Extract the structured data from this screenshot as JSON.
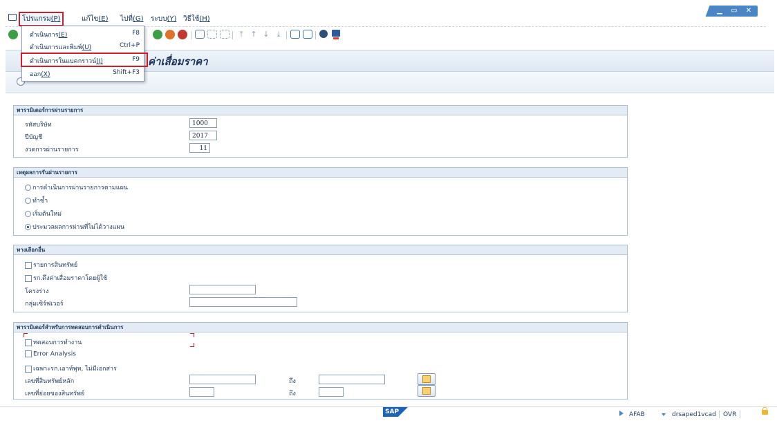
{
  "menubar": {
    "items": [
      {
        "label": "โปรแกรม",
        "accel": "(P)"
      },
      {
        "label": "แก้ไข",
        "accel": "(E)"
      },
      {
        "label": "ไปที่",
        "accel": "(G)"
      },
      {
        "label": "ระบบ",
        "accel": "(Y)"
      },
      {
        "label": "วิธีใช้",
        "accel": "(H)"
      }
    ]
  },
  "window": {
    "minimize": "▁",
    "maximize": "▭",
    "close": "✕"
  },
  "dropdown": {
    "items": [
      {
        "label": "ดำเนินการ",
        "accel": "(E)",
        "shortcut": "F8"
      },
      {
        "label": "ดำเนินการและพิมพ์",
        "accel": "(U)",
        "shortcut": "Ctrl+P"
      },
      {
        "label": "ดำเนินการในแบคกราวน์",
        "accel": "(I)",
        "shortcut": "F9"
      },
      {
        "label": "ออก",
        "accel": "(X)",
        "shortcut": "Shift+F3"
      }
    ],
    "highlighted_index": 2
  },
  "page": {
    "title": "ค่าเสื่อมราคา"
  },
  "posting_params": {
    "title": "พารามิเตอร์การผ่านรายการ",
    "company_code_label": "รหัสบริษัท",
    "company_code": "1000",
    "fiscal_year_label": "ปีบัญชี",
    "fiscal_year": "2017",
    "period_label": "งวดการผ่านรายการ",
    "period": "11"
  },
  "posting_reason": {
    "title": "เหตุผลการรันผ่านรายการ",
    "options": [
      {
        "label": "การดำเนินการผ่านรายการตามแผน",
        "selected": false
      },
      {
        "label": "ทำซ้ำ",
        "selected": false
      },
      {
        "label": "เริ่มต้นใหม่",
        "selected": false
      },
      {
        "label": "ประมวลผลการผ่านที่ไม่ได้วางแผน",
        "selected": true
      }
    ]
  },
  "options": {
    "title": "ทางเลือกอื่น",
    "list_assets_label": "รายการสินทรัพย์",
    "manual_depr_label": "รก.ดึงค่าเสื่อมราคาโดยผู้ใช้",
    "layout_label": "โครงร่าง",
    "layout_value": "",
    "server_group_label": "กลุ่มเซิร์ฟเวอร์",
    "server_group_value": ""
  },
  "test_params": {
    "title": "พารามิเตอร์สำหรับการทดสอบการดำเนินการ",
    "test_run_label": "ทดสอบการทำงาน",
    "error_analysis_label": "Error Analysis",
    "output_only_label": "เฉพาะรก.เอาท์พุท, ไม่มีเอกสาร",
    "main_asset_label": "เลขที่สินทรัพย์หลัก",
    "main_asset_from": "",
    "main_asset_to": "",
    "sub_asset_label": "เลขที่ย่อยของสินทรัพย์",
    "sub_asset_from": "",
    "sub_asset_to": "",
    "to_label": "ถึง"
  },
  "status": {
    "logo": "SAP",
    "system": "AFAB",
    "server": "drsaped1vcad",
    "mode": "OVR"
  },
  "icons": {
    "system-menu": "window-icon",
    "toolbar": [
      "back-icon",
      "exit-icon",
      "cancel-icon",
      "print-icon",
      "find-icon",
      "find-next-icon",
      "first-page-icon",
      "prev-page-icon",
      "next-page-icon",
      "last-page-icon",
      "new-session-icon",
      "shortcut-icon",
      "customize-icon",
      "help-icon"
    ]
  }
}
